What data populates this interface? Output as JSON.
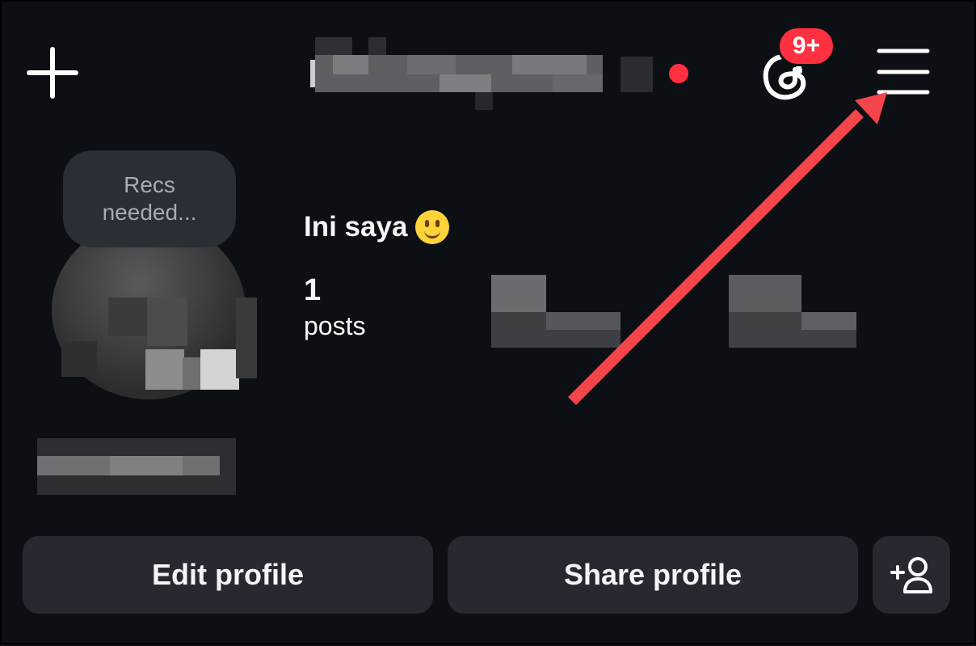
{
  "header": {
    "new_post_icon": "plus-icon",
    "threads_icon": "threads-icon",
    "notification_badge": "9+",
    "menu_icon": "hamburger-menu-icon",
    "live_dot_color": "#ff3040"
  },
  "profile": {
    "note_text": "Recs needed...",
    "display_name": "Ini saya",
    "display_name_emoji": "slightly-smiling-face",
    "posts_count": "1",
    "posts_label": "posts"
  },
  "actions": {
    "edit_profile_label": "Edit profile",
    "share_profile_label": "Share profile",
    "add_person_icon": "add-person-icon"
  },
  "colors": {
    "background": "#0c1014",
    "button_bg": "#262a30",
    "accent_red": "#ff3040",
    "annotation_arrow": "#f4454a"
  }
}
